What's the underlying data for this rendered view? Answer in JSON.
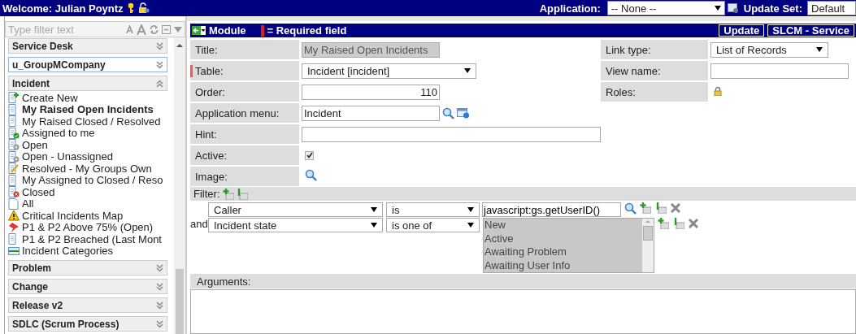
{
  "top_bar": {
    "welcome": "Welcome: Julian Poyntz",
    "application_label": "Application:",
    "application_value": "-- None --",
    "update_set_label": "Update Set:",
    "update_set_value": "Default"
  },
  "sidebar": {
    "filter_placeholder": "Type filter text",
    "sections": [
      {
        "title": "Service Desk",
        "expanded": false,
        "focused": false
      },
      {
        "title": "u_GroupMCompany",
        "expanded": false,
        "focused": true
      },
      {
        "title": "Incident",
        "expanded": true,
        "focused": false,
        "items": [
          {
            "label": "Create New",
            "kind": "new",
            "selected": false
          },
          {
            "label": "My Raised Open Incidents",
            "kind": "list",
            "selected": true
          },
          {
            "label": "My Raised Closed / Resolved",
            "kind": "list",
            "selected": false
          },
          {
            "label": "Assigned to me",
            "kind": "assigned",
            "selected": false
          },
          {
            "label": "Open",
            "kind": "open",
            "selected": false
          },
          {
            "label": "Open - Unassigned",
            "kind": "open",
            "selected": false
          },
          {
            "label": "Resolved - My Groups Own",
            "kind": "edit",
            "selected": false
          },
          {
            "label": "My Assigned to Closed / Reso",
            "kind": "list",
            "selected": false
          },
          {
            "label": "Closed",
            "kind": "closed",
            "selected": false
          },
          {
            "label": "All",
            "kind": "page",
            "selected": false
          },
          {
            "label": "Critical Incidents Map",
            "kind": "warning",
            "selected": false
          },
          {
            "label": "P1 & P2 Above 75% (Open)",
            "kind": "pin",
            "selected": false
          },
          {
            "label": "P1 & P2 Breached (Last Mont",
            "kind": "list",
            "selected": false
          },
          {
            "label": "Incident Categories",
            "kind": "categories",
            "selected": false
          }
        ]
      },
      {
        "title": "Problem",
        "expanded": false,
        "focused": false
      },
      {
        "title": "Change",
        "expanded": false,
        "focused": false
      },
      {
        "title": "Release v2",
        "expanded": false,
        "focused": false
      },
      {
        "title": "SDLC (Scrum Process)",
        "expanded": false,
        "focused": false
      }
    ]
  },
  "form": {
    "title": "Module",
    "required_legend": "= Required field",
    "buttons": [
      "Update",
      "SLCM - Service"
    ],
    "left_fields": [
      {
        "label": "Title:",
        "kind": "text",
        "value": "My Raised Open Incidents",
        "readonly": true,
        "required": false
      },
      {
        "label": "Table:",
        "kind": "select",
        "value": "Incident [incident]",
        "required": true
      },
      {
        "label": "Order:",
        "kind": "number",
        "value": "110",
        "readonly": false,
        "required": false
      },
      {
        "label": "Application menu:",
        "kind": "reference",
        "value": "Incident",
        "readonly": false,
        "required": false
      },
      {
        "label": "Hint:",
        "kind": "text",
        "readonly": false,
        "required": false
      },
      {
        "label": "Active:",
        "kind": "checkbox",
        "checked": true,
        "required": false
      },
      {
        "label": "Image:",
        "kind": "lookup",
        "required": false
      }
    ],
    "right_fields": [
      {
        "label": "Link type:",
        "kind": "select",
        "value": "List of Records"
      },
      {
        "label": "View name:",
        "kind": "text"
      },
      {
        "label": "Roles:",
        "kind": "lock"
      }
    ],
    "filter": {
      "label": "Filter:",
      "conditions": [
        {
          "field": "Caller",
          "operator": "is",
          "kind": "text",
          "value": "javascript:gs.getUserID()"
        },
        {
          "conjunction": "and",
          "field": "Incident state",
          "operator": "is one of",
          "kind": "list",
          "options": [
            "New",
            "Active",
            "Awaiting Problem",
            "Awaiting User Info"
          ]
        }
      ]
    },
    "arguments": {
      "label": "Arguments:"
    }
  }
}
